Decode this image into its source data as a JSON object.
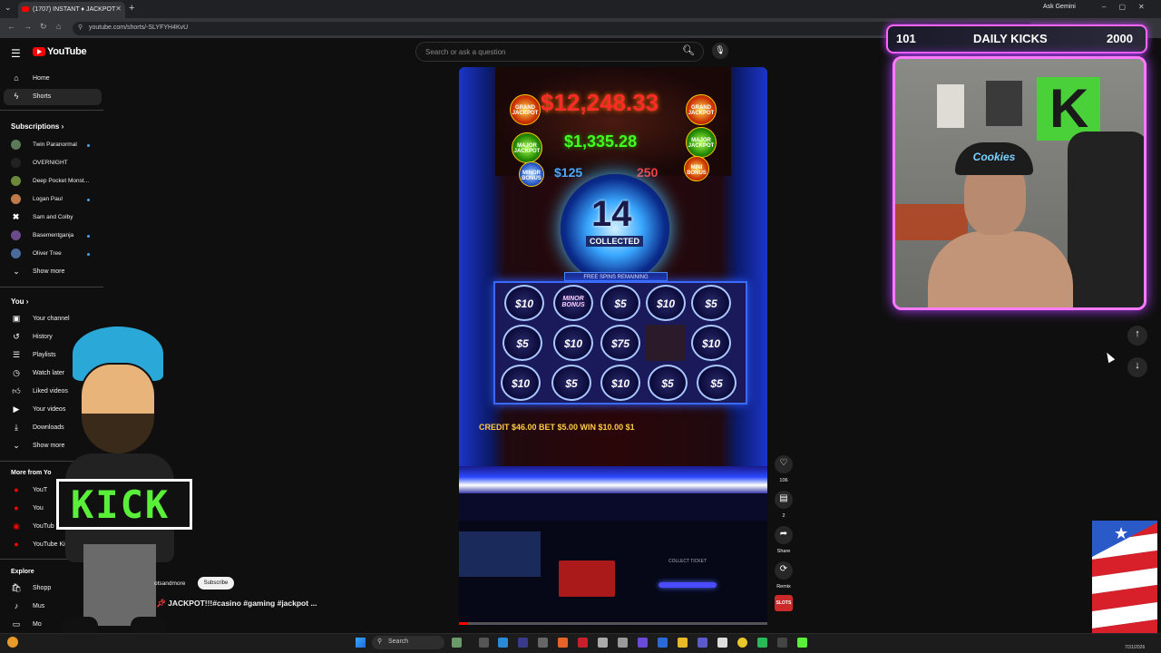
{
  "browser": {
    "tab_title": "(1707) INSTANT ♦ JACKPOT",
    "new_tab": "+",
    "ask_gemini": "Ask Gemini",
    "url": "youtube.com/shorts/-SLYFYH4KvU"
  },
  "youtube": {
    "logo_text": "YouTube",
    "search_placeholder": "Search or ask a question"
  },
  "sidebar": {
    "main": [
      {
        "label": "Home",
        "icon": "home-icon"
      },
      {
        "label": "Shorts",
        "icon": "shorts-icon"
      }
    ],
    "subscriptions_heading": "Subscriptions",
    "subscriptions": [
      {
        "label": "Twin Paranormal",
        "color": "#5a7a5a",
        "new": true
      },
      {
        "label": "OVERNIGHT",
        "color": "#222222",
        "new": false
      },
      {
        "label": "Deep Pocket Monst...",
        "color": "#6a8a3a",
        "new": false
      },
      {
        "label": "Logan Paul",
        "color": "#c07a4a",
        "new": true
      },
      {
        "label": "Sam and Colby",
        "color": "#dddddd",
        "new": false
      },
      {
        "label": "Basementganja",
        "color": "#6a4a8a",
        "new": true
      },
      {
        "label": "Oliver Tree",
        "color": "#4a6a9a",
        "new": true
      }
    ],
    "show_more": "Show more",
    "you_heading": "You",
    "you_items": [
      {
        "label": "Your channel",
        "icon": "channel-icon"
      },
      {
        "label": "History",
        "icon": "history-icon"
      },
      {
        "label": "Playlists",
        "icon": "playlists-icon"
      },
      {
        "label": "Watch later",
        "icon": "clock-icon"
      },
      {
        "label": "Liked videos",
        "icon": "thumbs-up-icon"
      },
      {
        "label": "Your videos",
        "icon": "video-icon"
      },
      {
        "label": "Downloads",
        "icon": "download-icon"
      }
    ],
    "show_more_2": "Show more",
    "more_heading": "More from Yo",
    "more_items": [
      {
        "label": "YouT"
      },
      {
        "label": "You"
      },
      {
        "label": "YouTub"
      },
      {
        "label": "YouTube Kid"
      }
    ],
    "explore_heading": "Explore",
    "explore_items": [
      {
        "label": "Shopp"
      },
      {
        "label": "Mus"
      },
      {
        "label": "Mo"
      }
    ]
  },
  "video": {
    "jackpot_grand": "$12,248.33",
    "jackpot_major": "$1,335.28",
    "jackpot_minor": "$125",
    "jackpot_mini": "250",
    "badge_grand": "GRAND JACKPOT",
    "badge_major": "MAJOR JACKPOT",
    "badge_minor": "MINOR BONUS",
    "badge_mini": "MINI BONUS",
    "collected_count": "14",
    "collected_label": "COLLECTED",
    "free_spins_label": "FREE SPINS REMAINING",
    "grid": [
      [
        "$10",
        "MINOR BONUS",
        "$5",
        "$10",
        "$5"
      ],
      [
        "$5",
        "$10",
        "$75",
        "",
        "$10"
      ],
      [
        "$10",
        "$5",
        "$10",
        "$5",
        "$5"
      ]
    ],
    "meter_text": "CREDIT $46.00   BET $5.00   WIN $10.00   $1",
    "ticket_label": "COLLECT TICKET",
    "progress_fraction": 0.03
  },
  "actions": {
    "like_count": "106",
    "comment_count": "2",
    "share_label": "Share",
    "remix_label": "Remix",
    "remix_thumb": "SLOTS"
  },
  "overlay": {
    "channel_name": "otsandmore",
    "subscribe_label": "Subscribe",
    "short_title": "JACKPOT!!!#casino #gaming #jackpot ..."
  },
  "stream": {
    "left_count": "101",
    "title": "DAILY KICKS",
    "right_count": "2000",
    "cap_text": "Cookies",
    "sign_text": "KICK"
  },
  "taskbar": {
    "search_label": "Search",
    "clock": "7/31/2026"
  },
  "colors": {
    "accent_red": "#ff0000",
    "overlay_pink": "#ff66ff",
    "kick_green": "#5af03a"
  }
}
